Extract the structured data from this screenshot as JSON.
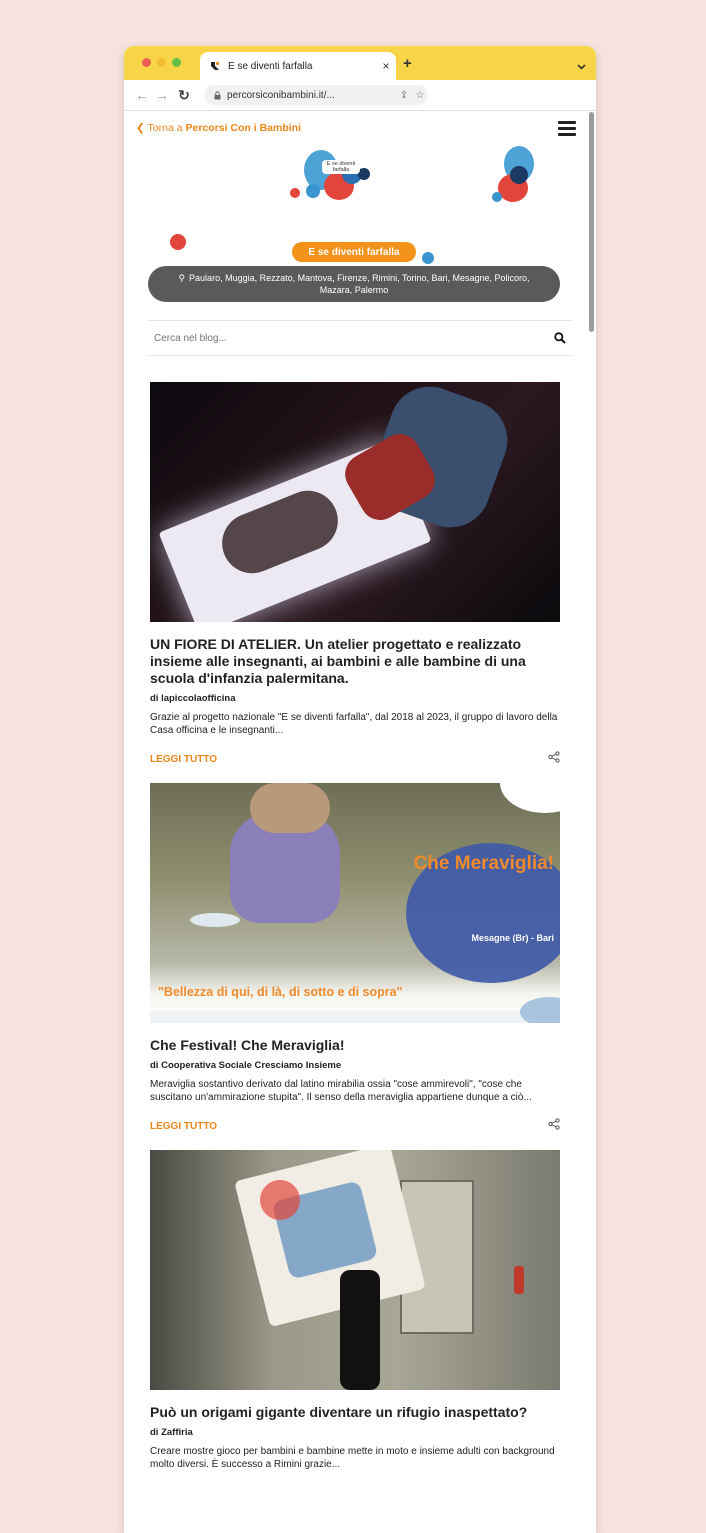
{
  "browser": {
    "tab_title": "E se diventi farfalla",
    "tab_close": "×",
    "new_tab": "+",
    "url": "percorsiconibambini.it/...",
    "accent": "#f8d548"
  },
  "header": {
    "back_prefix": "Torna a ",
    "back_site": "Percorsi Con i Bambini",
    "logo_text": "E se diventi farfalla"
  },
  "hero": {
    "project_label": "E se diventi farfalla",
    "locations": "Paularo, Muggia, Rezzato, Mantova, Firenze, Rimini, Torino, Bari, Mesagne, Policoro, Mazara, Palermo"
  },
  "search": {
    "placeholder": "Cerca nel blog..."
  },
  "posts": [
    {
      "title": "UN FIORE DI ATELIER. Un atelier progettato e realizzato insieme alle insegnanti, ai bambini e alle bambine di una scuola d'infanzia palermitana.",
      "author": "di lapiccolaofficina",
      "excerpt": "Grazie al progetto nazionale \"E se diventi farfalla\", dal 2018 al 2023, il gruppo di lavoro della Casa officina e le insegnanti...",
      "read_more": "LEGGI TUTTO"
    },
    {
      "title": "Che Festival! Che Meraviglia!",
      "author": "di Cooperativa Sociale Cresciamo Insieme",
      "excerpt": "Meraviglia sostantivo derivato dal latino mirabilia  ossia \"cose ammirevoli\", \"cose che suscitano un'ammirazione stupita\". Il senso della meraviglia appartiene dunque a ciò...",
      "read_more": "LEGGI TUTTO",
      "image_heading": "Che Meraviglia!",
      "image_place": "Mesagne (Br) - Bari",
      "image_tagline": "\"Bellezza di qui, di là, di sotto e di sopra\""
    },
    {
      "title": "Può un origami gigante diventare un rifugio inaspettato?",
      "author": "di Zaffiria",
      "excerpt": "Creare mostre gioco per bambini e bambine mette in moto e insieme adulti con background molto diversi. È successo a Rimini grazie..."
    }
  ]
}
